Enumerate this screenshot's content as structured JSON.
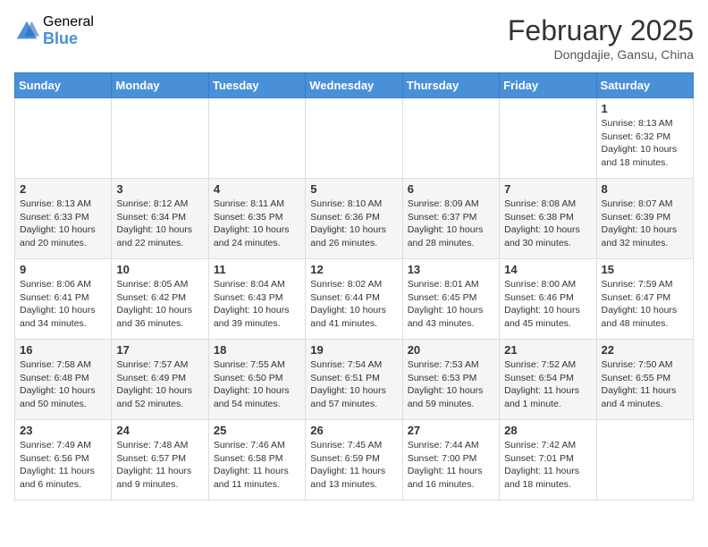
{
  "header": {
    "logo_general": "General",
    "logo_blue": "Blue",
    "month_title": "February 2025",
    "subtitle": "Dongdajie, Gansu, China"
  },
  "days_of_week": [
    "Sunday",
    "Monday",
    "Tuesday",
    "Wednesday",
    "Thursday",
    "Friday",
    "Saturday"
  ],
  "weeks": [
    [
      {
        "day": "",
        "info": ""
      },
      {
        "day": "",
        "info": ""
      },
      {
        "day": "",
        "info": ""
      },
      {
        "day": "",
        "info": ""
      },
      {
        "day": "",
        "info": ""
      },
      {
        "day": "",
        "info": ""
      },
      {
        "day": "1",
        "info": "Sunrise: 8:13 AM\nSunset: 6:32 PM\nDaylight: 10 hours\nand 18 minutes."
      }
    ],
    [
      {
        "day": "2",
        "info": "Sunrise: 8:13 AM\nSunset: 6:33 PM\nDaylight: 10 hours\nand 20 minutes."
      },
      {
        "day": "3",
        "info": "Sunrise: 8:12 AM\nSunset: 6:34 PM\nDaylight: 10 hours\nand 22 minutes."
      },
      {
        "day": "4",
        "info": "Sunrise: 8:11 AM\nSunset: 6:35 PM\nDaylight: 10 hours\nand 24 minutes."
      },
      {
        "day": "5",
        "info": "Sunrise: 8:10 AM\nSunset: 6:36 PM\nDaylight: 10 hours\nand 26 minutes."
      },
      {
        "day": "6",
        "info": "Sunrise: 8:09 AM\nSunset: 6:37 PM\nDaylight: 10 hours\nand 28 minutes."
      },
      {
        "day": "7",
        "info": "Sunrise: 8:08 AM\nSunset: 6:38 PM\nDaylight: 10 hours\nand 30 minutes."
      },
      {
        "day": "8",
        "info": "Sunrise: 8:07 AM\nSunset: 6:39 PM\nDaylight: 10 hours\nand 32 minutes."
      }
    ],
    [
      {
        "day": "9",
        "info": "Sunrise: 8:06 AM\nSunset: 6:41 PM\nDaylight: 10 hours\nand 34 minutes."
      },
      {
        "day": "10",
        "info": "Sunrise: 8:05 AM\nSunset: 6:42 PM\nDaylight: 10 hours\nand 36 minutes."
      },
      {
        "day": "11",
        "info": "Sunrise: 8:04 AM\nSunset: 6:43 PM\nDaylight: 10 hours\nand 39 minutes."
      },
      {
        "day": "12",
        "info": "Sunrise: 8:02 AM\nSunset: 6:44 PM\nDaylight: 10 hours\nand 41 minutes."
      },
      {
        "day": "13",
        "info": "Sunrise: 8:01 AM\nSunset: 6:45 PM\nDaylight: 10 hours\nand 43 minutes."
      },
      {
        "day": "14",
        "info": "Sunrise: 8:00 AM\nSunset: 6:46 PM\nDaylight: 10 hours\nand 45 minutes."
      },
      {
        "day": "15",
        "info": "Sunrise: 7:59 AM\nSunset: 6:47 PM\nDaylight: 10 hours\nand 48 minutes."
      }
    ],
    [
      {
        "day": "16",
        "info": "Sunrise: 7:58 AM\nSunset: 6:48 PM\nDaylight: 10 hours\nand 50 minutes."
      },
      {
        "day": "17",
        "info": "Sunrise: 7:57 AM\nSunset: 6:49 PM\nDaylight: 10 hours\nand 52 minutes."
      },
      {
        "day": "18",
        "info": "Sunrise: 7:55 AM\nSunset: 6:50 PM\nDaylight: 10 hours\nand 54 minutes."
      },
      {
        "day": "19",
        "info": "Sunrise: 7:54 AM\nSunset: 6:51 PM\nDaylight: 10 hours\nand 57 minutes."
      },
      {
        "day": "20",
        "info": "Sunrise: 7:53 AM\nSunset: 6:53 PM\nDaylight: 10 hours\nand 59 minutes."
      },
      {
        "day": "21",
        "info": "Sunrise: 7:52 AM\nSunset: 6:54 PM\nDaylight: 11 hours\nand 1 minute."
      },
      {
        "day": "22",
        "info": "Sunrise: 7:50 AM\nSunset: 6:55 PM\nDaylight: 11 hours\nand 4 minutes."
      }
    ],
    [
      {
        "day": "23",
        "info": "Sunrise: 7:49 AM\nSunset: 6:56 PM\nDaylight: 11 hours\nand 6 minutes."
      },
      {
        "day": "24",
        "info": "Sunrise: 7:48 AM\nSunset: 6:57 PM\nDaylight: 11 hours\nand 9 minutes."
      },
      {
        "day": "25",
        "info": "Sunrise: 7:46 AM\nSunset: 6:58 PM\nDaylight: 11 hours\nand 11 minutes."
      },
      {
        "day": "26",
        "info": "Sunrise: 7:45 AM\nSunset: 6:59 PM\nDaylight: 11 hours\nand 13 minutes."
      },
      {
        "day": "27",
        "info": "Sunrise: 7:44 AM\nSunset: 7:00 PM\nDaylight: 11 hours\nand 16 minutes."
      },
      {
        "day": "28",
        "info": "Sunrise: 7:42 AM\nSunset: 7:01 PM\nDaylight: 11 hours\nand 18 minutes."
      },
      {
        "day": "",
        "info": ""
      }
    ]
  ]
}
